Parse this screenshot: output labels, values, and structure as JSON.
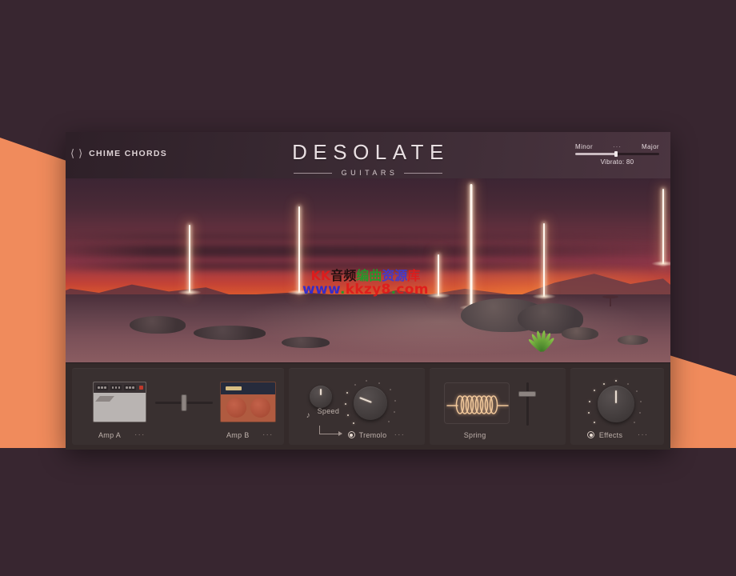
{
  "page": {
    "background_color": "#382630",
    "accent_color": "#f08b5c"
  },
  "plugin": {
    "header": {
      "prev_icon": "chevron-left-icon",
      "next_icon": "chevron-right-icon",
      "preset_name": "CHIME CHORDS",
      "brand_title": "DESOLATE",
      "brand_subtitle": "GUITARS",
      "morph": {
        "left_label": "Minor",
        "center_label": "···",
        "right_label": "Major",
        "value_label": "Vibrato: 80",
        "position_percent": 49
      }
    },
    "artwork": {
      "scene": "desert-sunset-light-beams",
      "watermark": {
        "line1_parts": [
          {
            "text": "KK",
            "color": "#e01b1b"
          },
          {
            "text": "音频",
            "color": "#1a0d0d"
          },
          {
            "text": "编曲",
            "color": "#19a02a"
          },
          {
            "text": "资源",
            "color": "#3a3ad6"
          },
          {
            "text": "库",
            "color": "#e01b1b"
          }
        ],
        "line2_parts": [
          {
            "text": "www",
            "color": "#2a2ad4"
          },
          {
            "text": ".",
            "color": "#19a02a"
          },
          {
            "text": "kkzy8",
            "color": "#e01b1b"
          },
          {
            "text": ".",
            "color": "#19a02a"
          },
          {
            "text": "com",
            "color": "#e01b1b"
          }
        ]
      }
    },
    "rack": {
      "amps": {
        "amp_a_label": "Amp A",
        "amp_a_menu": "···",
        "amp_b_label": "Amp B",
        "amp_b_menu": "···",
        "crossfader_percent": 50
      },
      "tremolo": {
        "speed_label": "Speed",
        "speed_icon": "music-note-icon",
        "speed_value_percent": 50,
        "name_label": "Tremolo",
        "menu": "···",
        "enabled": true,
        "depth_value_percent": 22
      },
      "spring": {
        "label": "Spring",
        "icon": "spring-coil-icon",
        "slider_percent": 76
      },
      "effects": {
        "name_label": "Effects",
        "menu": "···",
        "enabled": true,
        "knob_value_percent": 50
      }
    }
  }
}
